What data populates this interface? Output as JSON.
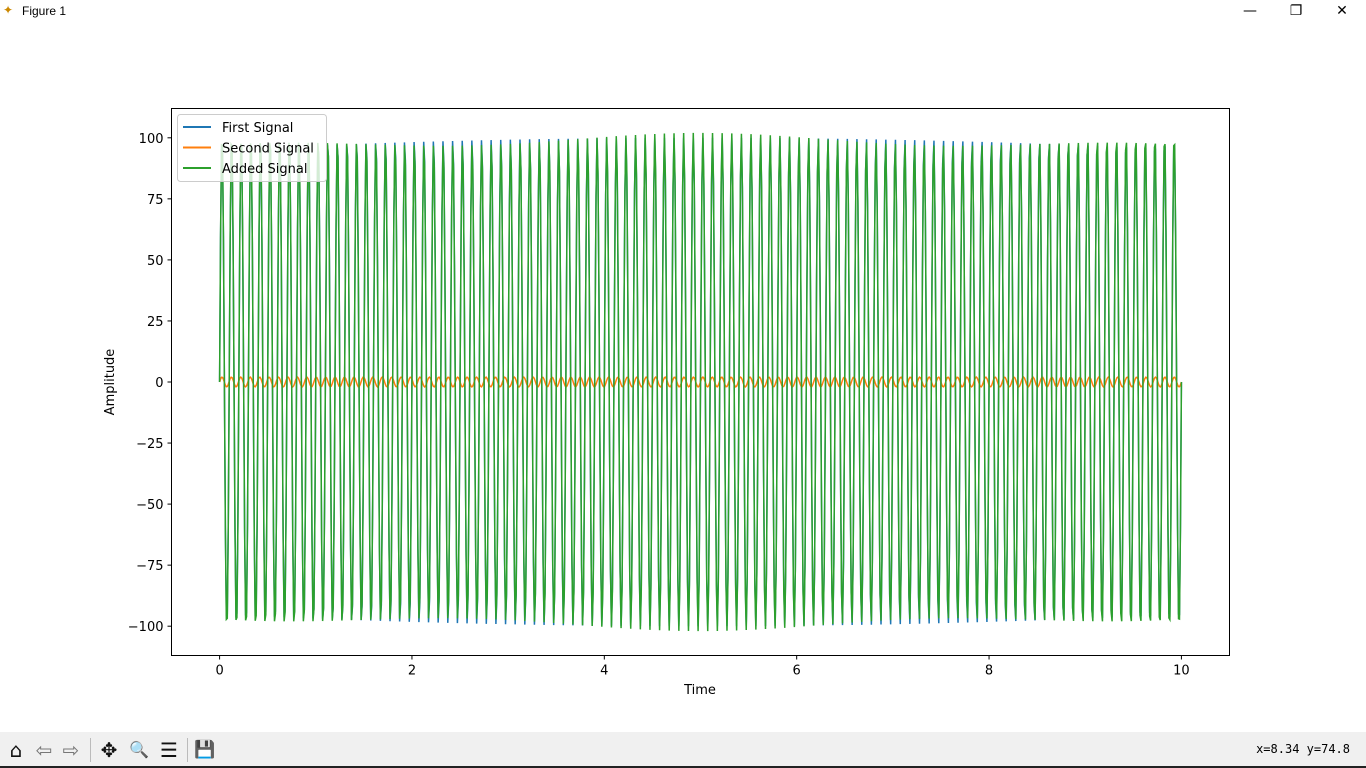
{
  "window": {
    "title": "Figure 1",
    "icon": "matplotlib-icon",
    "minimize": "—",
    "maximize": "❐",
    "close": "✕"
  },
  "toolbar": {
    "buttons": [
      {
        "name": "home-icon",
        "glyph": "⌂"
      },
      {
        "name": "back-icon",
        "glyph": "⇦"
      },
      {
        "name": "forward-icon",
        "glyph": "⇨"
      },
      {
        "name": "pan-icon",
        "glyph": "✥"
      },
      {
        "name": "zoom-icon",
        "glyph": "🔍"
      },
      {
        "name": "configure-subplots-icon",
        "glyph": "☰"
      },
      {
        "name": "save-icon",
        "glyph": "💾"
      }
    ],
    "coords": "x=8.34 y=74.8"
  },
  "chart_data": {
    "type": "line",
    "title": "",
    "xlabel": "Time",
    "ylabel": "Amplitude",
    "xlim": [
      -0.5,
      10.5
    ],
    "ylim": [
      -112,
      112
    ],
    "xticks": [
      0,
      2,
      4,
      6,
      8,
      10
    ],
    "yticks": [
      100,
      75,
      50,
      25,
      0,
      -25,
      -50,
      -75,
      -100
    ],
    "grid": false,
    "legend": "top-left",
    "x_range": [
      0,
      10
    ],
    "samples": 1000,
    "series": [
      {
        "name": "First Signal",
        "color": "#1f77b4",
        "form": "sine",
        "amplitude": 100,
        "frequency_hz": 10
      },
      {
        "name": "Second Signal",
        "color": "#ff7f0e",
        "form": "sine",
        "amplitude": 2,
        "frequency_hz": 10.2
      },
      {
        "name": "Added Signal",
        "color": "#2ca02c",
        "form": "sum of First Signal and Second Signal"
      }
    ]
  }
}
